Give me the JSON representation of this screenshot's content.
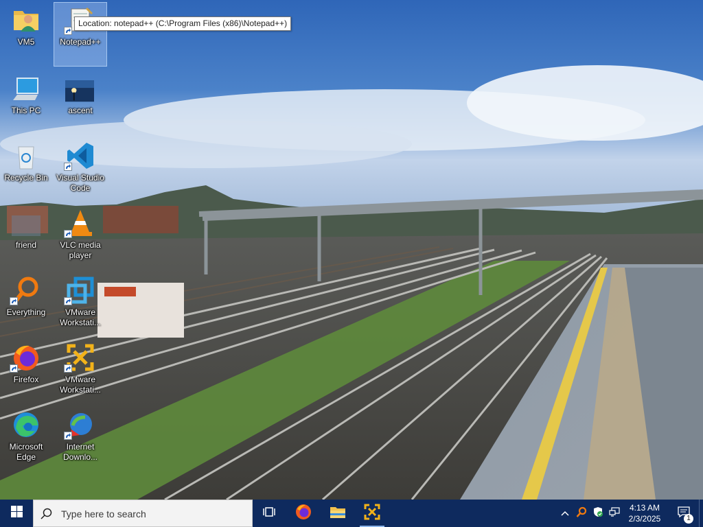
{
  "desktop": {
    "icons": [
      {
        "label": "VM5",
        "icon": "user-folder-icon"
      },
      {
        "label": "Notepad++",
        "icon": "notepad-plus-plus-icon"
      },
      {
        "label": "This PC",
        "icon": "computer-icon"
      },
      {
        "label": "ascent",
        "icon": "image-icon"
      },
      {
        "label": "Recycle Bin",
        "icon": "recycle-bin-icon"
      },
      {
        "label": "Visual Studio Code",
        "icon": "vscode-icon"
      },
      {
        "label": "friend",
        "icon": "image-icon"
      },
      {
        "label": "VLC media player",
        "icon": "vlc-icon"
      },
      {
        "label": "Everything",
        "icon": "everything-search-icon"
      },
      {
        "label": "VMware Workstati...",
        "icon": "vmware-icon"
      },
      {
        "label": "Firefox",
        "icon": "firefox-icon"
      },
      {
        "label": "VMware Workstati...",
        "icon": "vmware-alt-icon"
      },
      {
        "label": "Microsoft Edge",
        "icon": "edge-icon"
      },
      {
        "label": "Internet Downlo...",
        "icon": "idm-icon"
      }
    ],
    "tooltip": "Location: notepad++ (C:\\Program Files (x86)\\Notepad++)"
  },
  "taskbar": {
    "search_placeholder": "Type here to search",
    "pinned": [
      "task-view-icon",
      "firefox-icon",
      "file-explorer-icon",
      "vmware-icon"
    ],
    "tray_icons": [
      "chevron-up-icon",
      "everything-search-icon",
      "security-shield-icon",
      "network-icon"
    ],
    "time": "4:13 AM",
    "date": "2/3/2025",
    "notification_count": "1"
  },
  "colors": {
    "taskbar": "#0e2a5e",
    "accent": "#0078d7"
  }
}
